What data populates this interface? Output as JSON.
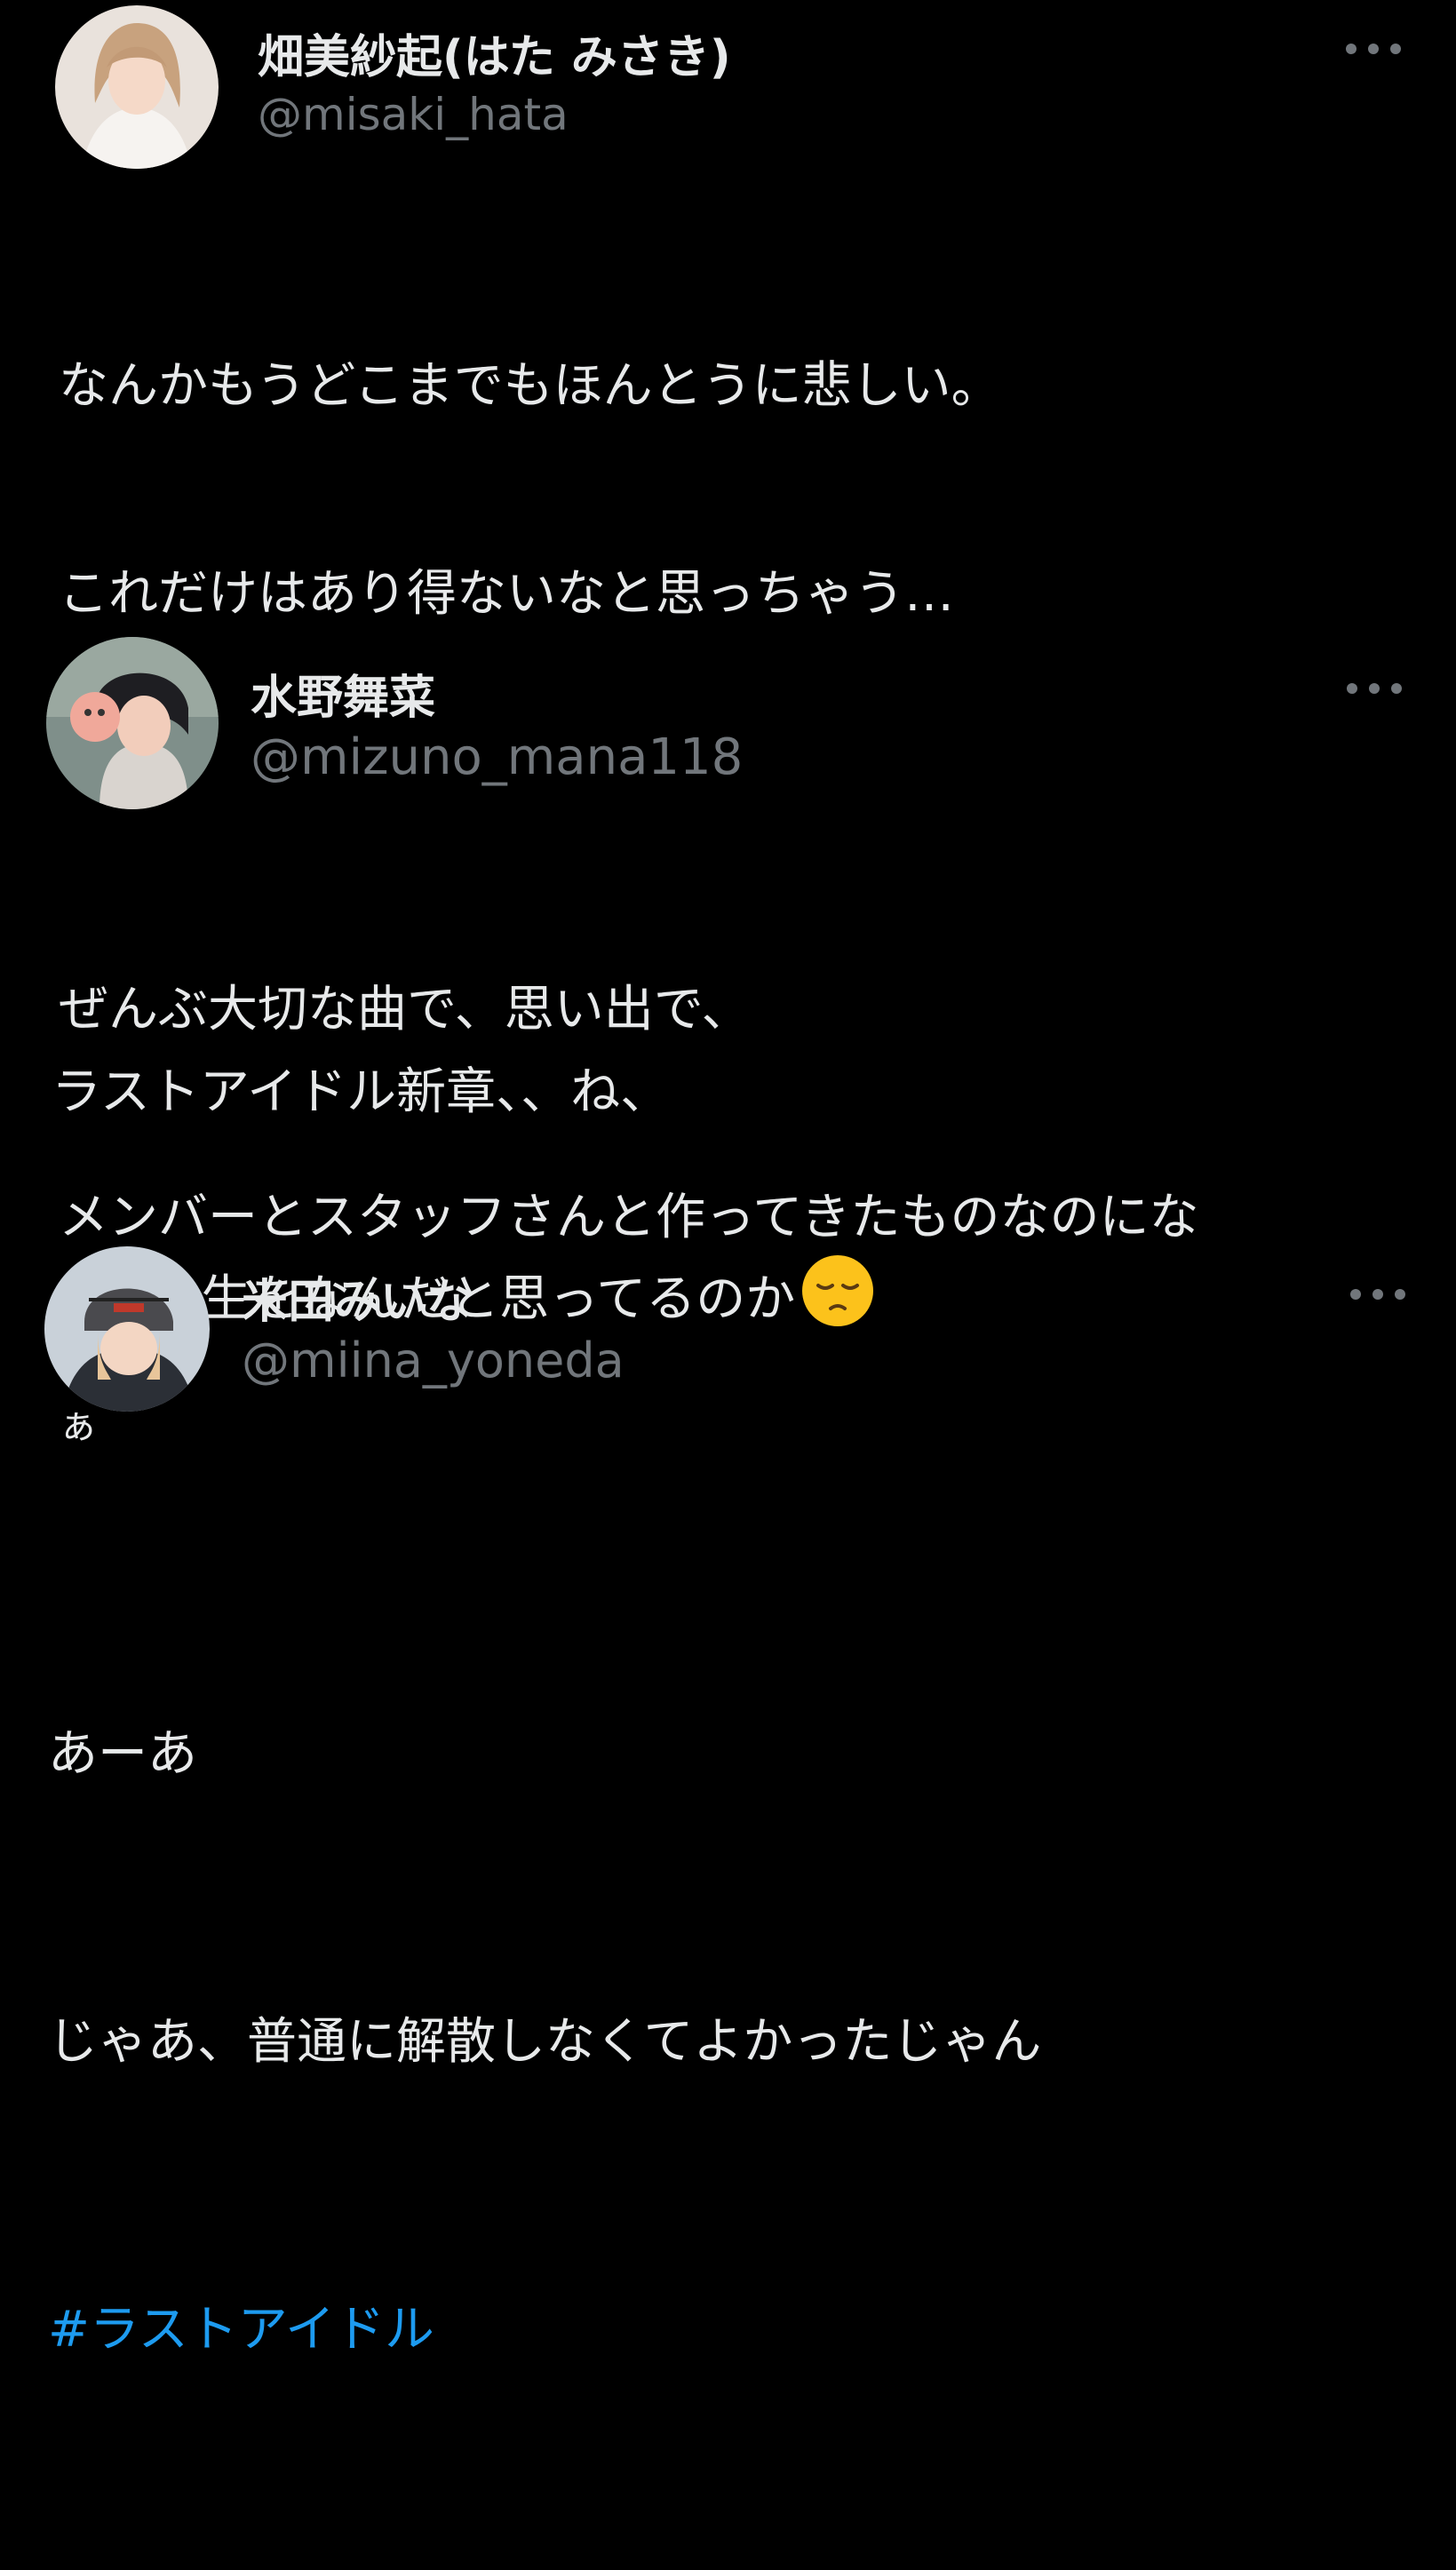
{
  "tweets": [
    {
      "name": "畑美紗起(はた みさき)",
      "handle": "@misaki_hata",
      "lines": [
        "なんかもうどこまでもほんとうに悲しい。",
        "これだけはあり得ないなと思っちゃう…",
        "",
        "ぜんぶ大切な曲で、思い出で、",
        "メンバーとスタッフさんと作ってきたものなのにな",
        "ぁ"
      ]
    },
    {
      "name": "水野舞菜",
      "handle": "@mizuno_mana118",
      "lines": [
        "ラストアイドル新章、、ね、",
        "人の人生をなんだと思ってるのか"
      ],
      "emoji": "pensive-face"
    },
    {
      "name": "米田みいな",
      "handle": "@miina_yoneda",
      "lines": [
        "あーあ",
        "じゃあ、普通に解散しなくてよかったじゃん"
      ],
      "hashtag": "#ラストアイドル"
    }
  ],
  "colors": {
    "background": "#000000",
    "text": "#e7e9ea",
    "secondary": "#71767b",
    "link": "#1d9bf0"
  }
}
